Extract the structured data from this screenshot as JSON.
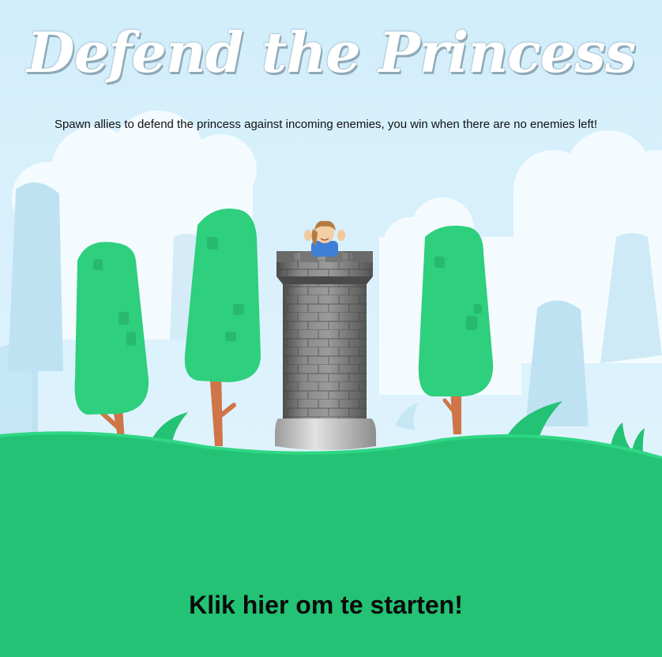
{
  "game": {
    "title": "Defend the Princess",
    "description": "Spawn allies to defend the princess against incoming enemies, you win when there are no enemies left!",
    "start_prompt": "Klik hier om te starten!"
  },
  "colors": {
    "sky": "#d3eefb",
    "grass": "#23c274",
    "tree_foliage": "#2ecf7d",
    "trunk": "#cf7548",
    "tower_stone": "#7d7d7d"
  },
  "icons": [
    "princess-icon",
    "tower-icon",
    "tree-icon",
    "bush-icon",
    "cloud-icon"
  ]
}
